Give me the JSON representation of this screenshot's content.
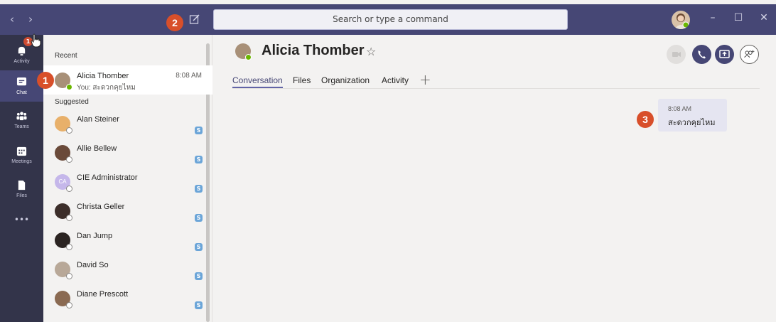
{
  "topbar": {
    "search_placeholder": "Search or type a command",
    "back": "‹",
    "forward": "›",
    "minimize": "–",
    "maximize": "☐",
    "close": "✕"
  },
  "rail": {
    "items": [
      {
        "label": "Activity",
        "icon": "bell-icon"
      },
      {
        "label": "Chat",
        "icon": "chat-icon"
      },
      {
        "label": "Teams",
        "icon": "teams-icon"
      },
      {
        "label": "Meetings",
        "icon": "calendar-icon"
      },
      {
        "label": "Files",
        "icon": "file-icon"
      }
    ],
    "more": "•••",
    "activity_badge": "1"
  },
  "list": {
    "recent_label": "Recent",
    "suggested_label": "Suggested",
    "recent": [
      {
        "name": "Alicia Thomber",
        "preview": "You: สะดวกคุยไหม",
        "time": "8:08 AM"
      }
    ],
    "suggested": [
      {
        "name": "Alan Steiner"
      },
      {
        "name": "Allie Bellew"
      },
      {
        "name": "CIE Administrator",
        "initials": "CA"
      },
      {
        "name": "Christa Geller"
      },
      {
        "name": "Dan Jump"
      },
      {
        "name": "David So"
      },
      {
        "name": "Diane Prescott"
      }
    ],
    "skype_glyph": "S"
  },
  "chat": {
    "name": "Alicia Thomber",
    "star": "☆",
    "tabs": [
      "Conversation",
      "Files",
      "Organization",
      "Activity"
    ],
    "add_tab": "+",
    "message": {
      "time": "8:08 AM",
      "text": "สะดวกคุยไหม"
    }
  },
  "callouts": [
    "1",
    "2",
    "3"
  ],
  "colors": {
    "titlebar": "#464775",
    "rail": "#33344a",
    "accent": "#6264a7",
    "callout": "#d84f2a",
    "online": "#6bb700"
  }
}
